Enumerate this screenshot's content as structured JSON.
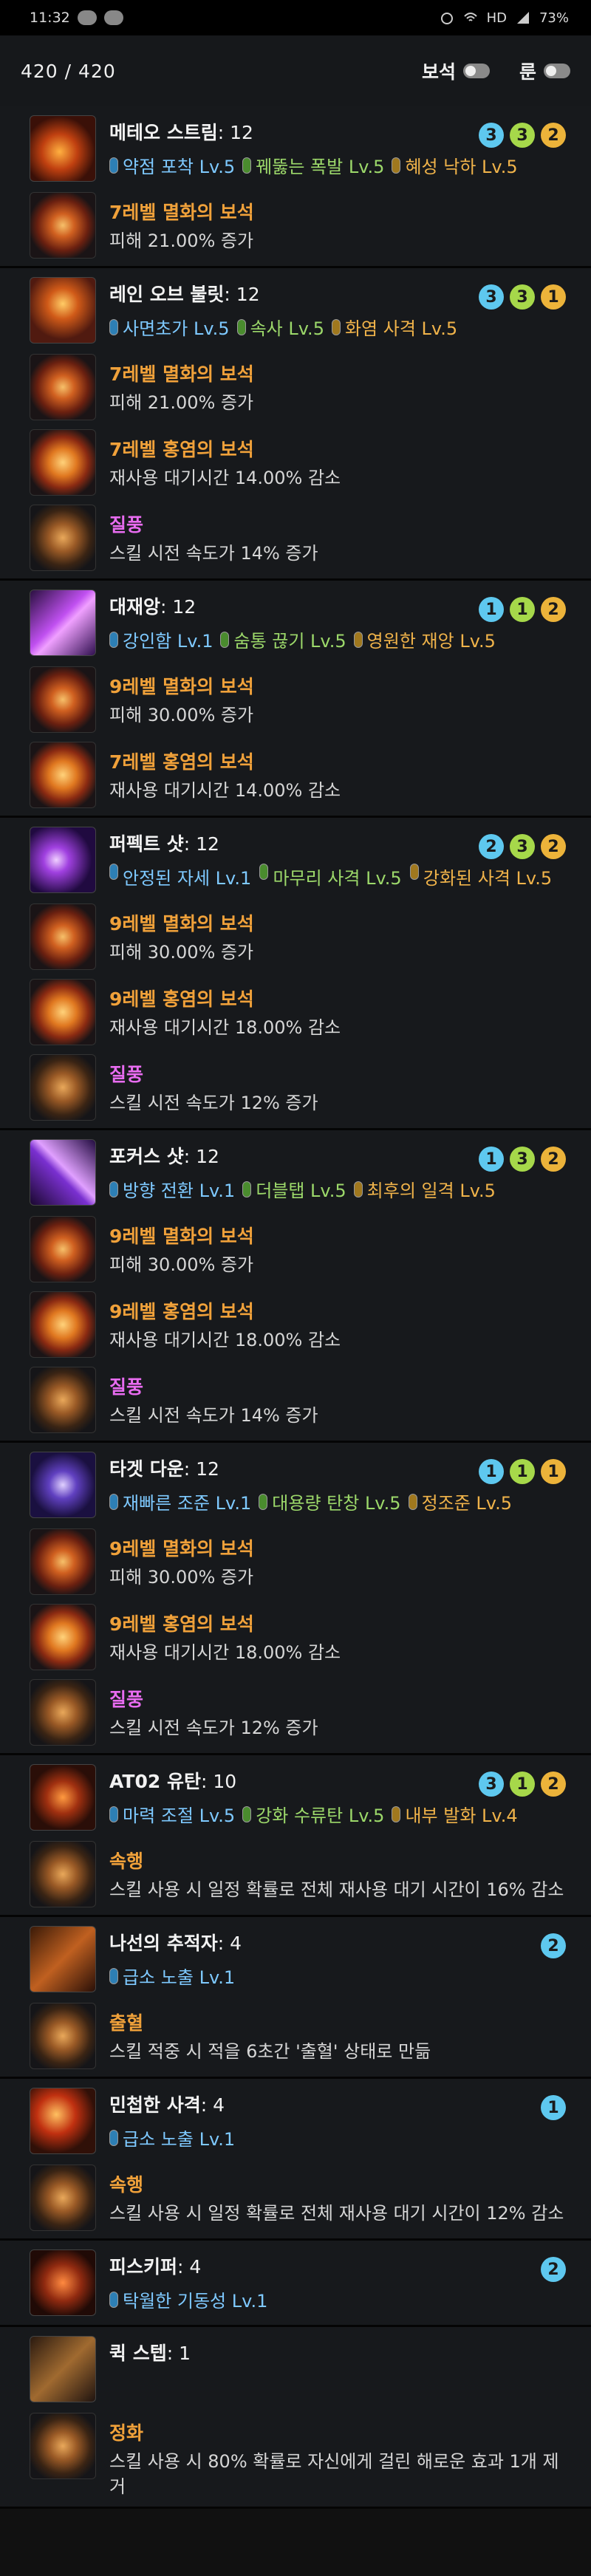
{
  "status": {
    "time": "11:32",
    "signal_text": "HD",
    "battery": "73%"
  },
  "header": {
    "points": "420 /   420",
    "gem_toggle_label": "보석",
    "rune_toggle_label": "룬"
  },
  "skills": [
    {
      "name": "메테오 스트림",
      "level": ": 12",
      "icon": "meteor-skill-icon",
      "badges": [
        {
          "v": "3",
          "c": "b1"
        },
        {
          "v": "3",
          "c": "b2"
        },
        {
          "v": "2",
          "c": "b3"
        }
      ],
      "tripods": [
        {
          "t": "t1",
          "label": "약점 포착 Lv.5"
        },
        {
          "t": "t2",
          "label": "꿰뚫는 폭발 Lv.5"
        },
        {
          "t": "t3",
          "label": "혜성 낙하 Lv.5"
        }
      ],
      "subs": [
        {
          "kind": "gem-fire",
          "title": "7레벨 멸화의 보석",
          "desc": "피해 21.00% 증가"
        }
      ]
    },
    {
      "name": "레인 오브 불릿",
      "level": ": 12",
      "icon": "rain-of-bullets-skill-icon",
      "badges": [
        {
          "v": "3",
          "c": "b1"
        },
        {
          "v": "3",
          "c": "b2"
        },
        {
          "v": "1",
          "c": "b3"
        }
      ],
      "tripods": [
        {
          "t": "t1",
          "label": "사면초가 Lv.5"
        },
        {
          "t": "t2",
          "label": "속사 Lv.5"
        },
        {
          "t": "t3",
          "label": "화염 사격 Lv.5"
        }
      ],
      "subs": [
        {
          "kind": "gem-fire",
          "title": "7레벨 멸화의 보석",
          "desc": "피해 21.00% 증가"
        },
        {
          "kind": "gem-red",
          "title": "7레벨 홍염의 보석",
          "desc": "재사용 대기시간 14.00% 감소"
        },
        {
          "kind": "rune",
          "title": "질풍",
          "purple": true,
          "desc": "스킬 시전 속도가 14% 증가"
        }
      ]
    },
    {
      "name": "대재앙",
      "level": ": 12",
      "icon": "catastrophe-skill-icon",
      "badges": [
        {
          "v": "1",
          "c": "b1"
        },
        {
          "v": "1",
          "c": "b2"
        },
        {
          "v": "2",
          "c": "b3"
        }
      ],
      "tripods": [
        {
          "t": "t1",
          "label": "강인함 Lv.1"
        },
        {
          "t": "t2",
          "label": "숨통 끊기 Lv.5"
        },
        {
          "t": "t3",
          "label": "영원한 재앙 Lv.5"
        }
      ],
      "subs": [
        {
          "kind": "gem-fire",
          "title": "9레벨 멸화의 보석",
          "desc": "피해 30.00% 증가"
        },
        {
          "kind": "gem-red",
          "title": "7레벨 홍염의 보석",
          "desc": "재사용 대기시간 14.00% 감소"
        }
      ]
    },
    {
      "name": "퍼펙트 샷",
      "level": ": 12",
      "icon": "perfect-shot-skill-icon",
      "cols": true,
      "badges": [
        {
          "v": "2",
          "c": "b1"
        },
        {
          "v": "3",
          "c": "b2"
        },
        {
          "v": "2",
          "c": "b3"
        }
      ],
      "tripods": [
        {
          "t": "t1",
          "label": "안정된 자세 Lv.1"
        },
        {
          "t": "t2",
          "label": "마무리 사격 Lv.5"
        },
        {
          "t": "t3",
          "label": "강화된 사격 Lv.5"
        }
      ],
      "subs": [
        {
          "kind": "gem-fire",
          "title": "9레벨 멸화의 보석",
          "desc": "피해 30.00% 증가"
        },
        {
          "kind": "gem-red",
          "title": "9레벨 홍염의 보석",
          "desc": "재사용 대기시간 18.00% 감소"
        },
        {
          "kind": "rune",
          "title": "질풍",
          "purple": true,
          "desc": "스킬 시전 속도가 12% 증가"
        }
      ]
    },
    {
      "name": "포커스 샷",
      "level": ": 12",
      "icon": "focus-shot-skill-icon",
      "badges": [
        {
          "v": "1",
          "c": "b1"
        },
        {
          "v": "3",
          "c": "b2"
        },
        {
          "v": "2",
          "c": "b3"
        }
      ],
      "tripods": [
        {
          "t": "t1",
          "label": "방향 전환 Lv.1"
        },
        {
          "t": "t2",
          "label": "더블탭 Lv.5"
        },
        {
          "t": "t3",
          "label": "최후의 일격 Lv.5"
        }
      ],
      "subs": [
        {
          "kind": "gem-fire",
          "title": "9레벨 멸화의 보석",
          "desc": "피해 30.00% 증가"
        },
        {
          "kind": "gem-red",
          "title": "9레벨 홍염의 보석",
          "desc": "재사용 대기시간 18.00% 감소"
        },
        {
          "kind": "rune",
          "title": "질풍",
          "purple": true,
          "desc": "스킬 시전 속도가 14% 증가"
        }
      ]
    },
    {
      "name": "타겟 다운",
      "level": ": 12",
      "icon": "target-down-skill-icon",
      "badges": [
        {
          "v": "1",
          "c": "b1"
        },
        {
          "v": "1",
          "c": "b2"
        },
        {
          "v": "1",
          "c": "b3"
        }
      ],
      "tripods": [
        {
          "t": "t1",
          "label": "재빠른 조준 Lv.1"
        },
        {
          "t": "t2",
          "label": "대용량 탄창 Lv.5"
        },
        {
          "t": "t3",
          "label": "정조준 Lv.5"
        }
      ],
      "subs": [
        {
          "kind": "gem-fire",
          "title": "9레벨 멸화의 보석",
          "desc": "피해 30.00% 증가"
        },
        {
          "kind": "gem-red",
          "title": "9레벨 홍염의 보석",
          "desc": "재사용 대기시간 18.00% 감소"
        },
        {
          "kind": "rune",
          "title": "질풍",
          "purple": true,
          "desc": "스킬 시전 속도가 12% 증가"
        }
      ]
    },
    {
      "name": "AT02 유탄",
      "level": ": 10",
      "icon": "at02-grenade-skill-icon",
      "badges": [
        {
          "v": "3",
          "c": "b1"
        },
        {
          "v": "1",
          "c": "b2"
        },
        {
          "v": "2",
          "c": "b3"
        }
      ],
      "tripods": [
        {
          "t": "t1",
          "label": "마력 조절 Lv.5"
        },
        {
          "t": "t2",
          "label": "강화 수류탄 Lv.5"
        },
        {
          "t": "t3",
          "label": "내부 발화 Lv.4"
        }
      ],
      "subs": [
        {
          "kind": "rune",
          "title": "속행",
          "desc": "스킬 사용 시 일정 확률로 전체 재사용 대기 시간이 16% 감소"
        }
      ]
    },
    {
      "name": "나선의 추적자",
      "level": ": 4",
      "icon": "spiral-tracker-skill-icon",
      "badges": [
        {
          "v": "2",
          "c": "b1"
        }
      ],
      "tripods": [
        {
          "t": "t1",
          "label": "급소 노출 Lv.1"
        }
      ],
      "subs": [
        {
          "kind": "rune",
          "title": "출혈",
          "desc": "스킬 적중 시 적을 6초간 '출혈' 상태로 만듦"
        }
      ]
    },
    {
      "name": "민첩한 사격",
      "level": ": 4",
      "icon": "agile-shot-skill-icon",
      "badges": [
        {
          "v": "1",
          "c": "b1"
        }
      ],
      "tripods": [
        {
          "t": "t1",
          "label": "급소 노출 Lv.1"
        }
      ],
      "subs": [
        {
          "kind": "rune",
          "title": "속행",
          "desc": "스킬 사용 시 일정 확률로 전체 재사용 대기 시간이 12% 감소"
        }
      ]
    },
    {
      "name": "피스키퍼",
      "level": ": 4",
      "icon": "peacekeeper-skill-icon",
      "badges": [
        {
          "v": "2",
          "c": "b1"
        }
      ],
      "tripods": [
        {
          "t": "t1",
          "label": "탁월한 기동성 Lv.1"
        }
      ],
      "subs": []
    },
    {
      "name": "퀵 스텝",
      "level": ": 1",
      "icon": "quick-step-skill-icon",
      "badges": [],
      "tripods": [],
      "subs": [
        {
          "kind": "rune",
          "title": "정화",
          "desc": "스킬 사용 시 80% 확률로 자신에게 걸린 해로운 효과 1개 제거"
        }
      ]
    }
  ],
  "colors": {
    "tripod1": "#7ec9ff",
    "tripod2": "#9cd86a",
    "tripod3": "#f0b34a",
    "gem_title": "#f0a13a",
    "rune_purple": "#e86cf0"
  }
}
